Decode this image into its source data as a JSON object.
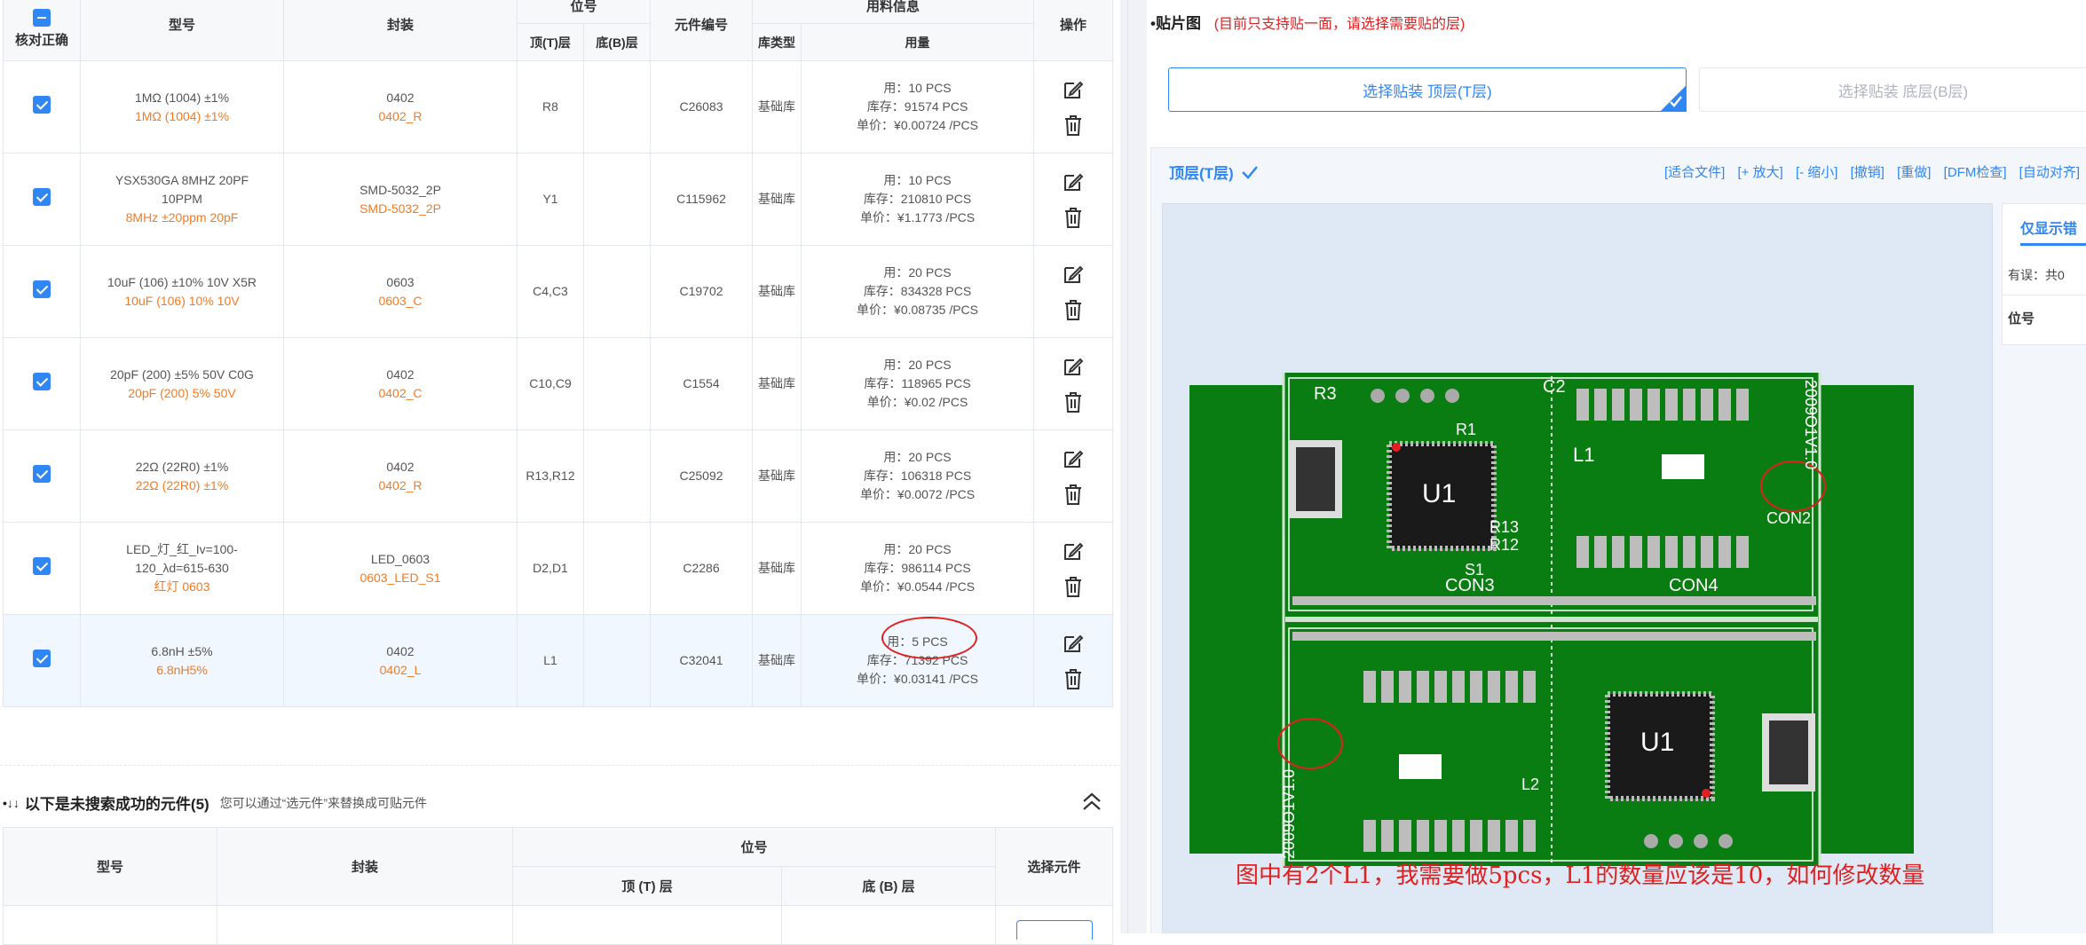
{
  "bom": {
    "headers": {
      "check": "核对正确",
      "model": "型号",
      "package": "封装",
      "designator": "位号",
      "top": "顶(T)层",
      "bottom": "底(B)层",
      "part_no": "元件编号",
      "material": "用料信息",
      "lib_type": "库类型",
      "usage": "用量",
      "action": "操作"
    },
    "rows": [
      {
        "model": "1MΩ (1004) ±1%",
        "model_alt": "1MΩ (1004) ±1%",
        "package": "0402",
        "package_alt": "0402_R",
        "top": "R8",
        "bottom": "",
        "part_no": "C26083",
        "lib": "基础库",
        "use": "用：10 PCS",
        "stock": "库存：91574 PCS",
        "price": "单价：¥0.00724 /PCS"
      },
      {
        "model": "YSX530GA 8MHZ 20PF 10PPM",
        "model_alt": "8MHz ±20ppm 20pF",
        "package": "SMD-5032_2P",
        "package_alt": "SMD-5032_2P",
        "top": "Y1",
        "bottom": "",
        "part_no": "C115962",
        "lib": "基础库",
        "use": "用：10 PCS",
        "stock": "库存：210810 PCS",
        "price": "单价：¥1.1773 /PCS"
      },
      {
        "model": "10uF (106) ±10% 10V X5R",
        "model_alt": "10uF (106) 10% 10V",
        "package": "0603",
        "package_alt": "0603_C",
        "top": "C4,C3",
        "bottom": "",
        "part_no": "C19702",
        "lib": "基础库",
        "use": "用：20 PCS",
        "stock": "库存：834328 PCS",
        "price": "单价：¥0.08735 /PCS"
      },
      {
        "model": "20pF (200) ±5% 50V C0G",
        "model_alt": "20pF (200) 5% 50V",
        "package": "0402",
        "package_alt": "0402_C",
        "top": "C10,C9",
        "bottom": "",
        "part_no": "C1554",
        "lib": "基础库",
        "use": "用：20 PCS",
        "stock": "库存：118965 PCS",
        "price": "单价：¥0.02 /PCS"
      },
      {
        "model": "22Ω (22R0) ±1%",
        "model_alt": "22Ω (22R0) ±1%",
        "package": "0402",
        "package_alt": "0402_R",
        "top": "R13,R12",
        "bottom": "",
        "part_no": "C25092",
        "lib": "基础库",
        "use": "用：20 PCS",
        "stock": "库存：106318 PCS",
        "price": "单价：¥0.0072 /PCS"
      },
      {
        "model": "LED_灯_红_Iv=100-120_λd=615-630",
        "model_alt": "红灯 0603",
        "package": "LED_0603",
        "package_alt": "0603_LED_S1",
        "top": "D2,D1",
        "bottom": "",
        "part_no": "C2286",
        "lib": "基础库",
        "use": "用：20 PCS",
        "stock": "库存：986114 PCS",
        "price": "单价：¥0.0544 /PCS"
      },
      {
        "model": "6.8nH ±5%",
        "model_alt": "6.8nH5%",
        "package": "0402",
        "package_alt": "0402_L",
        "top": "L1",
        "bottom": "",
        "part_no": "C32041",
        "lib": "基础库",
        "use": "用：5 PCS",
        "stock": "库存：71392 PCS",
        "price": "单价：¥0.03141 /PCS"
      }
    ]
  },
  "missing": {
    "title": "以下是未搜索成功的元件(5)",
    "hint": "您可以通过“选元件”来替换成可贴元件",
    "headers": {
      "model": "型号",
      "package": "封装",
      "designator": "位号",
      "top": "顶 (T) 层",
      "bottom": "底 (B) 层",
      "select": "选择元件"
    }
  },
  "smt": {
    "title": "贴片图",
    "note": "(目前只支持贴一面，请选择需要贴的层)",
    "btn_top": "选择贴装 顶层(T层)",
    "btn_bottom": "选择贴装 底层(B层)",
    "layer_label": "顶层(T层)",
    "tools": [
      "[适合文件]",
      "[+ 放大]",
      "[- 缩小]",
      "[撤销]",
      "[重做]",
      "[DFM检查]",
      "[自动对齐]",
      "["
    ],
    "side_tab": "仅显示错",
    "side_err": "有误：共0",
    "side_pos": "位号",
    "annotation": "图中有2个L1，我需要做5pcs，L1的数量应该是10，如何修改数量"
  },
  "pcb_labels": {
    "u_top": "U1",
    "u_bottom": "U1",
    "con2": "CON2",
    "con3": "CON3",
    "con4": "CON4",
    "l1": "L1",
    "l2": "L2",
    "r3": "R3",
    "s1": "S1",
    "c2": "C2",
    "r1": "R1",
    "r12": "R12",
    "r13": "R13",
    "date_top": "2009O1V1.0",
    "date_bottom": "2009O1V1.0"
  },
  "colors": {
    "accent": "#2f86f5",
    "orange": "#f47a20",
    "red": "#e02020",
    "pcb_green": "#0a7d12"
  }
}
